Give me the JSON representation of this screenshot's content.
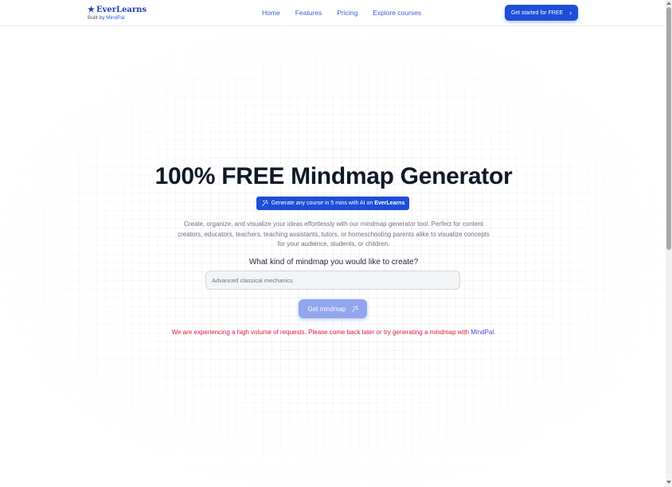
{
  "header": {
    "brand_name": "EverLearns",
    "brand_sub_prefix": "Built by ",
    "brand_sub_link": "MindPal",
    "nav": [
      "Home",
      "Features",
      "Pricing",
      "Explore courses"
    ],
    "cta_label": "Get started for FREE"
  },
  "hero": {
    "title": "100% FREE Mindmap Generator",
    "badge_prefix": "Generate any course in 5 mins with AI on ",
    "badge_brand": "EverLearns",
    "description": "Create, organize, and visualize your ideas effortlessly with our mindmap generator tool. Perfect for content creators, educators, teachers, teaching assistants, tutors, or homeschooling parents alike to visualize concepts for your audience, students, or children.",
    "question": "What kind of mindmap you would like to create?",
    "input_placeholder": "Advanced classical mechanics",
    "button_label": "Get mindmap",
    "error_prefix": "We are experiencing a high volume of requests. Please come back later or try generating a mindmap with ",
    "error_link": "MindPal",
    "error_suffix": "."
  },
  "colors": {
    "brand": "#1d4ed8",
    "button_disabled": "#93a5ee",
    "error": "#e11d48",
    "nav_link": "#3b5bdb"
  },
  "icons": {
    "brand": "star-icon",
    "cta": "chevron-right-icon",
    "badge": "magic-wand-icon",
    "button": "magic-wand-icon"
  }
}
